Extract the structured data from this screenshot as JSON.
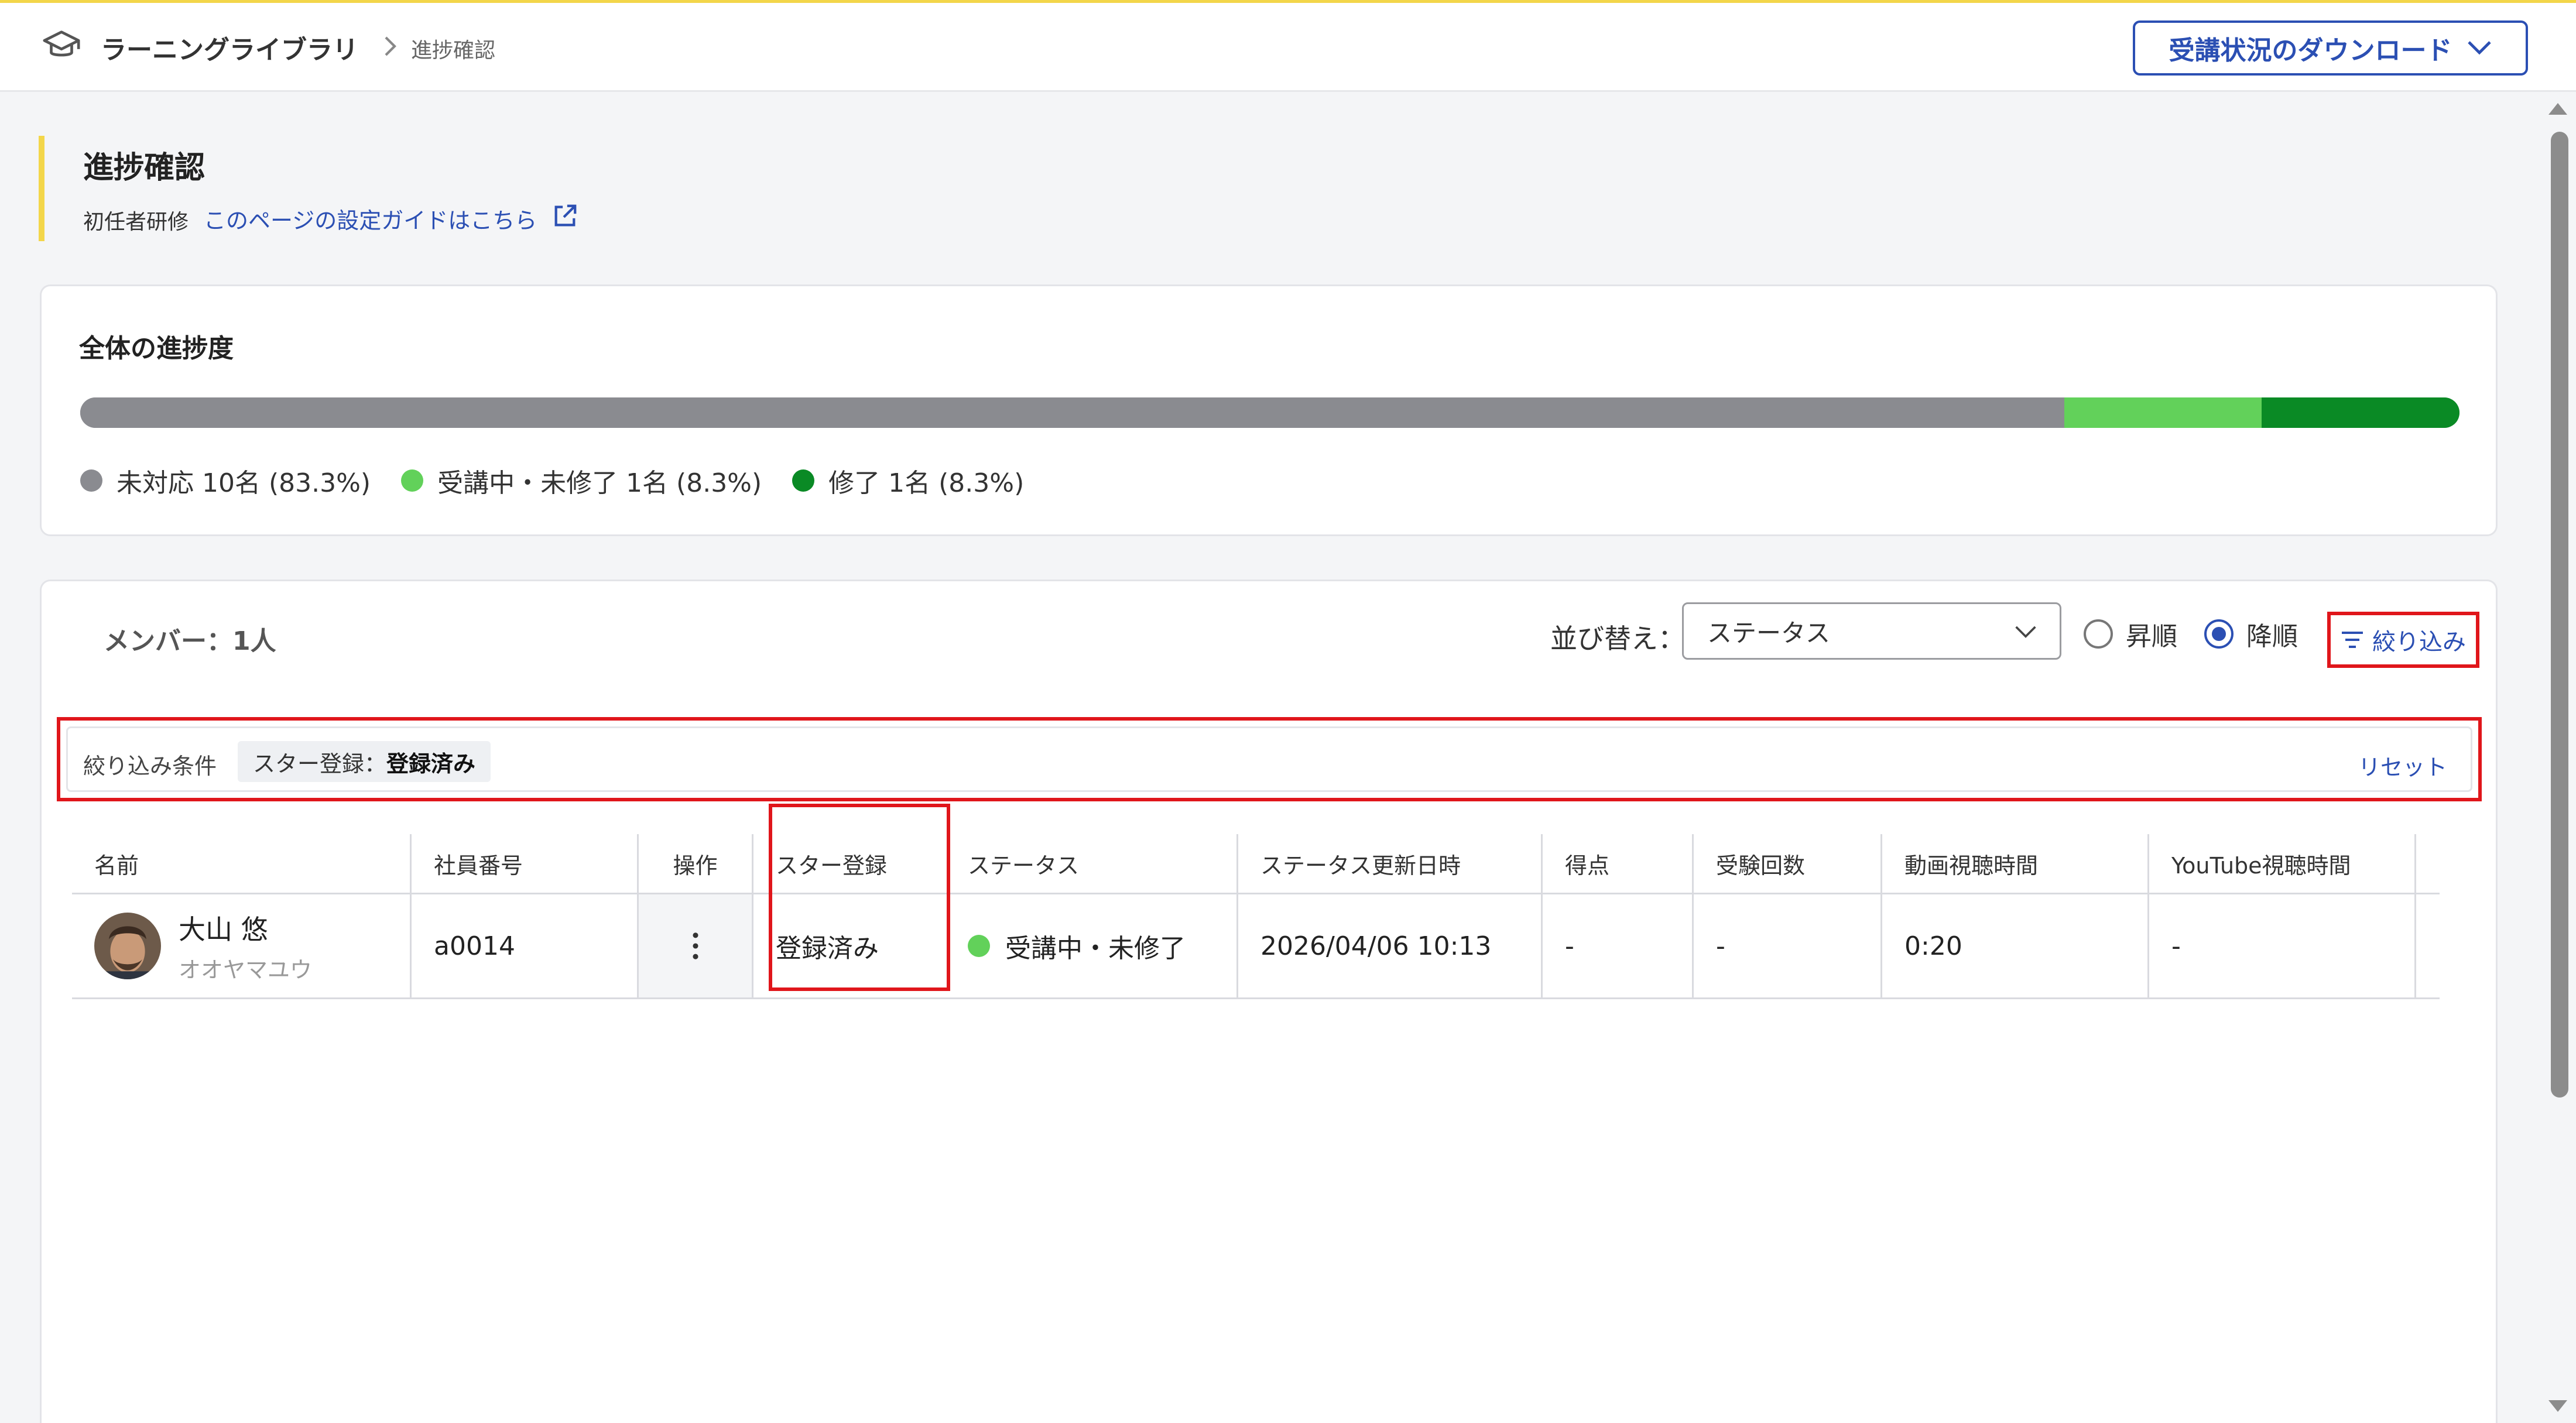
{
  "header": {
    "app_title": "ラーニングライブラリ",
    "breadcrumb_current": "進捗確認",
    "download_label": "受講状況のダウンロード"
  },
  "page": {
    "title": "進捗確認",
    "course": "初任者研修",
    "guide_link": "このページの設定ガイドはこちら"
  },
  "progress": {
    "title": "全体の進捗度",
    "segments": [
      {
        "label": "未対応 10名 (83.3%)",
        "percent": 83.3,
        "color": "#8a8b90"
      },
      {
        "label": "受講中・未修了 1名 (8.3%)",
        "percent": 8.3,
        "color": "#62d15a"
      },
      {
        "label": "修了 1名 (8.3%)",
        "percent": 8.3,
        "color": "#0a8a25"
      }
    ]
  },
  "members": {
    "count_label": "メンバー：1人",
    "sort_label": "並び替え：",
    "sort_value": "ステータス",
    "order_asc": "昇順",
    "order_desc": "降順",
    "order_selected": "desc",
    "filter_button": "絞り込み",
    "filter_conditions_label": "絞り込み条件",
    "filter_chip_key": "スター登録：",
    "filter_chip_value": "登録済み",
    "reset_label": "リセット"
  },
  "table": {
    "headers": [
      "名前",
      "社員番号",
      "操作",
      "スター登録",
      "ステータス",
      "ステータス更新日時",
      "得点",
      "受験回数",
      "動画視聴時間",
      "YouTube視聴時間"
    ],
    "rows": [
      {
        "name": "大山 悠",
        "kana": "オオヤマユウ",
        "employee_id": "a0014",
        "star": "登録済み",
        "status": "受講中・未修了",
        "updated": "2026/04/06 10:13",
        "score": "-",
        "attempts": "-",
        "video_time": "0:20",
        "youtube_time": "-"
      }
    ]
  },
  "colors": {
    "accent": "#2b4fb3",
    "highlight": "#e0161b",
    "brand_yellow": "#f3d64a"
  }
}
